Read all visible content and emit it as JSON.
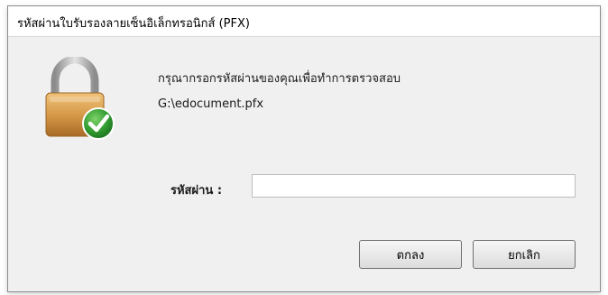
{
  "window": {
    "title": "รหัสผ่านใบรับรองลายเซ็นอิเล็กทรอนิกส์ (PFX)"
  },
  "content": {
    "icon": "padlock-with-checkmark-icon",
    "prompt": "กรุณากรอกรหัสผ่านของคุณเพื่อทำการตรวจสอบ",
    "file_path": "G:\\edocument.pfx"
  },
  "password": {
    "label": "รหัสผ่าน :",
    "value": ""
  },
  "buttons": {
    "ok_label": "ตกลง",
    "cancel_label": "ยกเลิก"
  },
  "colors": {
    "lock_body": "#c98a3a",
    "lock_shackle": "#b8b8b8",
    "check_badge": "#2f9a2f"
  }
}
